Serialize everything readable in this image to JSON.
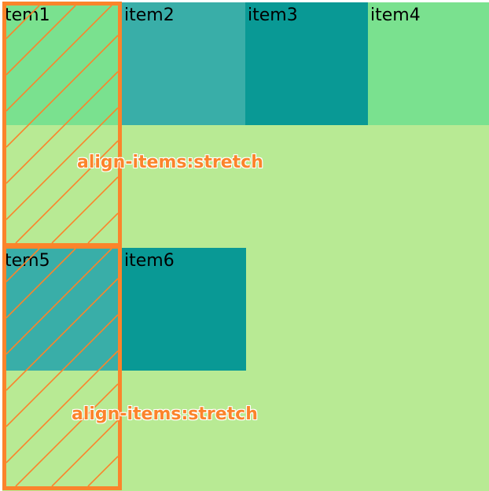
{
  "colors": {
    "background": "#b8ea94",
    "green": "#7ae18f",
    "teal_light": "#39aea8",
    "teal_dark": "#099995",
    "accent": "#fb842b"
  },
  "row1": {
    "items": [
      {
        "label": "tem1",
        "color": "#7ae18f"
      },
      {
        "label": "item2",
        "color": "#39aea8"
      },
      {
        "label": "item3",
        "color": "#099995"
      },
      {
        "label": "item4",
        "color": "#7ae18f"
      }
    ],
    "caption": "align-items:stretch"
  },
  "row2": {
    "items": [
      {
        "label": "tem5",
        "color": "#39aea8"
      },
      {
        "label": "item6",
        "color": "#099995"
      }
    ],
    "caption": "align-items:stretch"
  }
}
